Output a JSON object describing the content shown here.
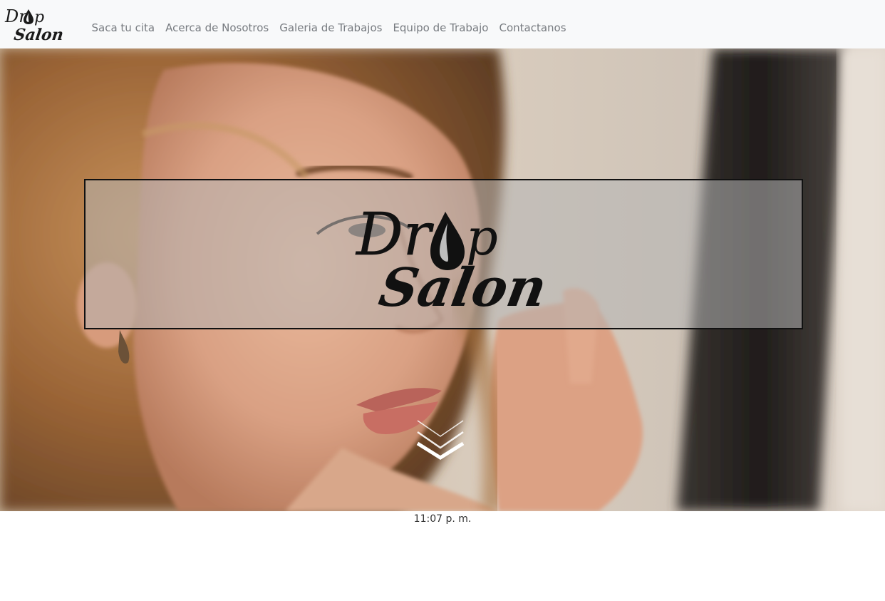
{
  "brand": {
    "logo_text_top": "Drop",
    "logo_text_bottom": "Salon"
  },
  "nav": {
    "items": [
      {
        "label": "Saca tu cita"
      },
      {
        "label": "Acerca de Nosotros"
      },
      {
        "label": "Galeria de Trabajos"
      },
      {
        "label": "Equipo de Trabajo"
      },
      {
        "label": "Contactanos"
      }
    ]
  },
  "hero": {
    "logo_text_top": "Drop",
    "logo_text_bottom": "Salon",
    "scroll_icon": "double-chevron-down-icon"
  },
  "footer": {
    "time": "11:07 p. m."
  },
  "colors": {
    "navbar_bg": "#f8f9fa",
    "nav_link": "#777b80",
    "logo_box_border": "#111111"
  }
}
